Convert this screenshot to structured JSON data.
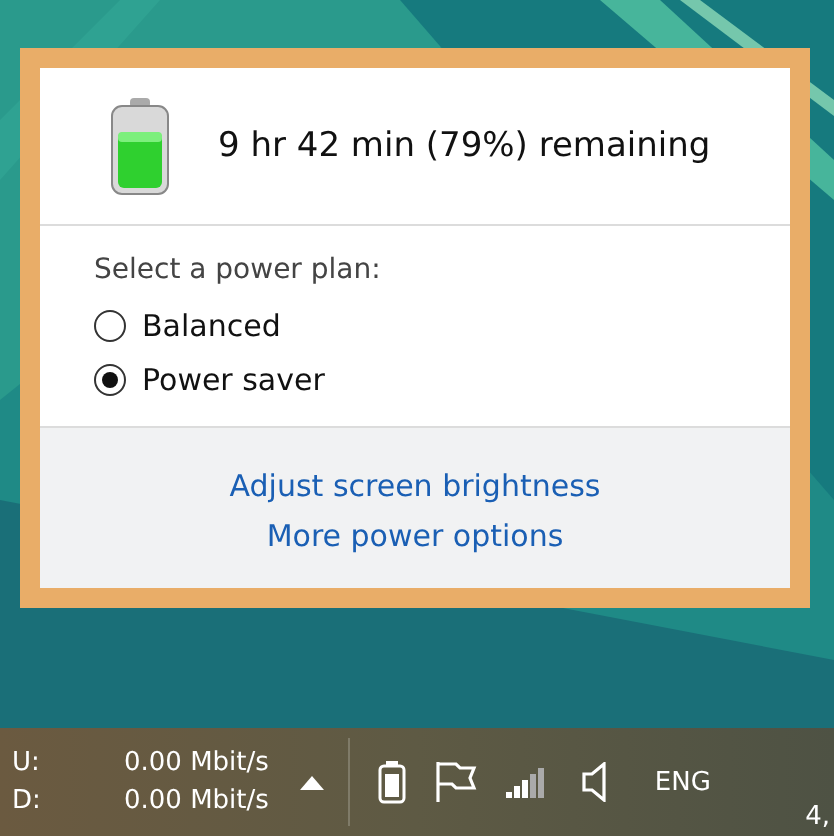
{
  "flyout": {
    "status": "9 hr 42 min (79%) remaining",
    "plan_heading": "Select a power plan:",
    "plans": [
      {
        "label": "Balanced",
        "selected": false
      },
      {
        "label": "Power saver",
        "selected": true
      }
    ],
    "links": [
      "Adjust screen brightness",
      "More power options"
    ]
  },
  "taskbar": {
    "network": [
      {
        "label": "U:",
        "value": "0.00 Mbit/s"
      },
      {
        "label": "D:",
        "value": "0.00 Mbit/s"
      }
    ],
    "language": "ENG",
    "clock": "4,"
  }
}
